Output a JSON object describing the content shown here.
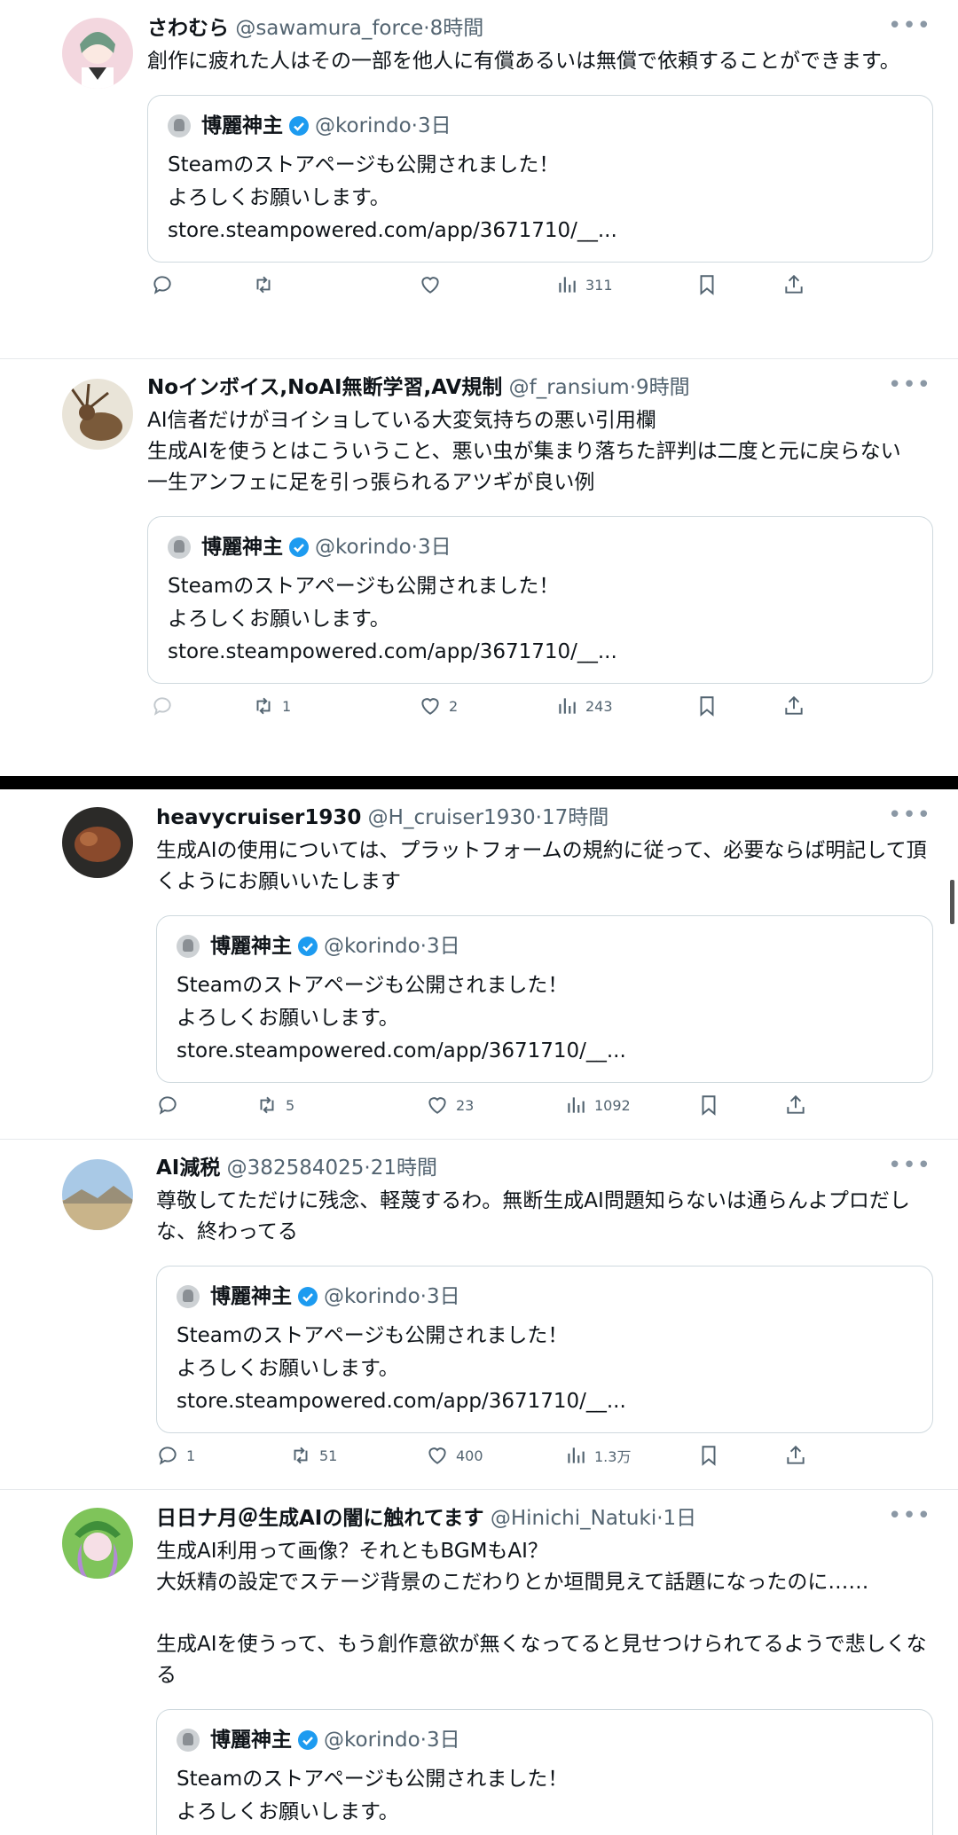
{
  "quoted": {
    "name": "博麗神主",
    "handle": "@korindo",
    "time": "3日",
    "text": "Steamのストアページも公開されました！\nよろしくお願いします。\nstore.steampowered.com/app/3671710/__..."
  },
  "tweets": [
    {
      "name": "さわむら",
      "handle": "@sawamura_force",
      "time": "8時間",
      "text": "創作に疲れた人はその一部を他人に有償あるいは無償で依頼することができます。",
      "reply_count": "",
      "retweet_count": "",
      "like_count": "",
      "view_count": "311",
      "avatar_colors": [
        "#f3d7df",
        "#6f9a84"
      ]
    },
    {
      "name": "NoインボイスNoAI無断学習AV規制",
      "display_name": "Noインボイス,NoAI無断学習,AV規制",
      "handle": "@f_ransium",
      "time": "9時間",
      "text": "AI信者だけがヨイショしている大変気持ちの悪い引用欄\n生成AIを使うとはこういうこと、悪い虫が集まり落ちた評判は二度と元に戻らない\n一生アンフェに足を引っ張られるアツギが良い例",
      "reply_count": "",
      "retweet_count": "1",
      "like_count": "2",
      "view_count": "243",
      "avatar_colors": [
        "#e9e4d8",
        "#7a5a3a"
      ]
    },
    {
      "name": "heavycruiser1930",
      "handle": "@H_cruiser1930",
      "time": "17時間",
      "text": "生成AIの使用については、プラットフォームの規約に従って、必要ならば明記して頂くようにお願いいたします",
      "reply_count": "",
      "retweet_count": "5",
      "like_count": "23",
      "view_count": "1092",
      "avatar_colors": [
        "#2b2a28",
        "#8a4a2c"
      ]
    },
    {
      "name": "AI減税",
      "handle": "@382584025",
      "time": "21時間",
      "text": "尊敬してただけに残念、軽蔑するわ。無断生成AI問題知らないは通らんよプロだしな、終わってる",
      "reply_count": "1",
      "retweet_count": "51",
      "like_count": "400",
      "view_count": "1.3万",
      "avatar_colors": [
        "#a9c9e6",
        "#c9b48a"
      ]
    },
    {
      "name": "日日ナ月＠生成AIの闇に触れてます",
      "handle": "@Hinichi_Natuki",
      "time": "1日",
      "text": "生成AI利用って画像？それともBGMもAI？\n大妖精の設定でステージ背景のこだわりとか垣間見えて話題になったのに……\n\n生成AIを使うって、もう創作意欲が無くなってると見せつけられてるようで悲しくなる",
      "reply_count": "",
      "retweet_count": "",
      "like_count": "",
      "view_count": "",
      "avatar_colors": [
        "#7fc45a",
        "#b38ad6"
      ]
    }
  ],
  "icons": {
    "reply": "reply-icon",
    "retweet": "retweet-icon",
    "like": "heart-icon",
    "views": "views-icon",
    "bookmark": "bookmark-icon",
    "share": "share-icon",
    "more": "more-icon",
    "verified": "verified-badge-icon"
  },
  "colors": {
    "text": "#0f1419",
    "secondary": "#536471",
    "verified": "#1d9bf0",
    "border": "#cfd9de"
  }
}
